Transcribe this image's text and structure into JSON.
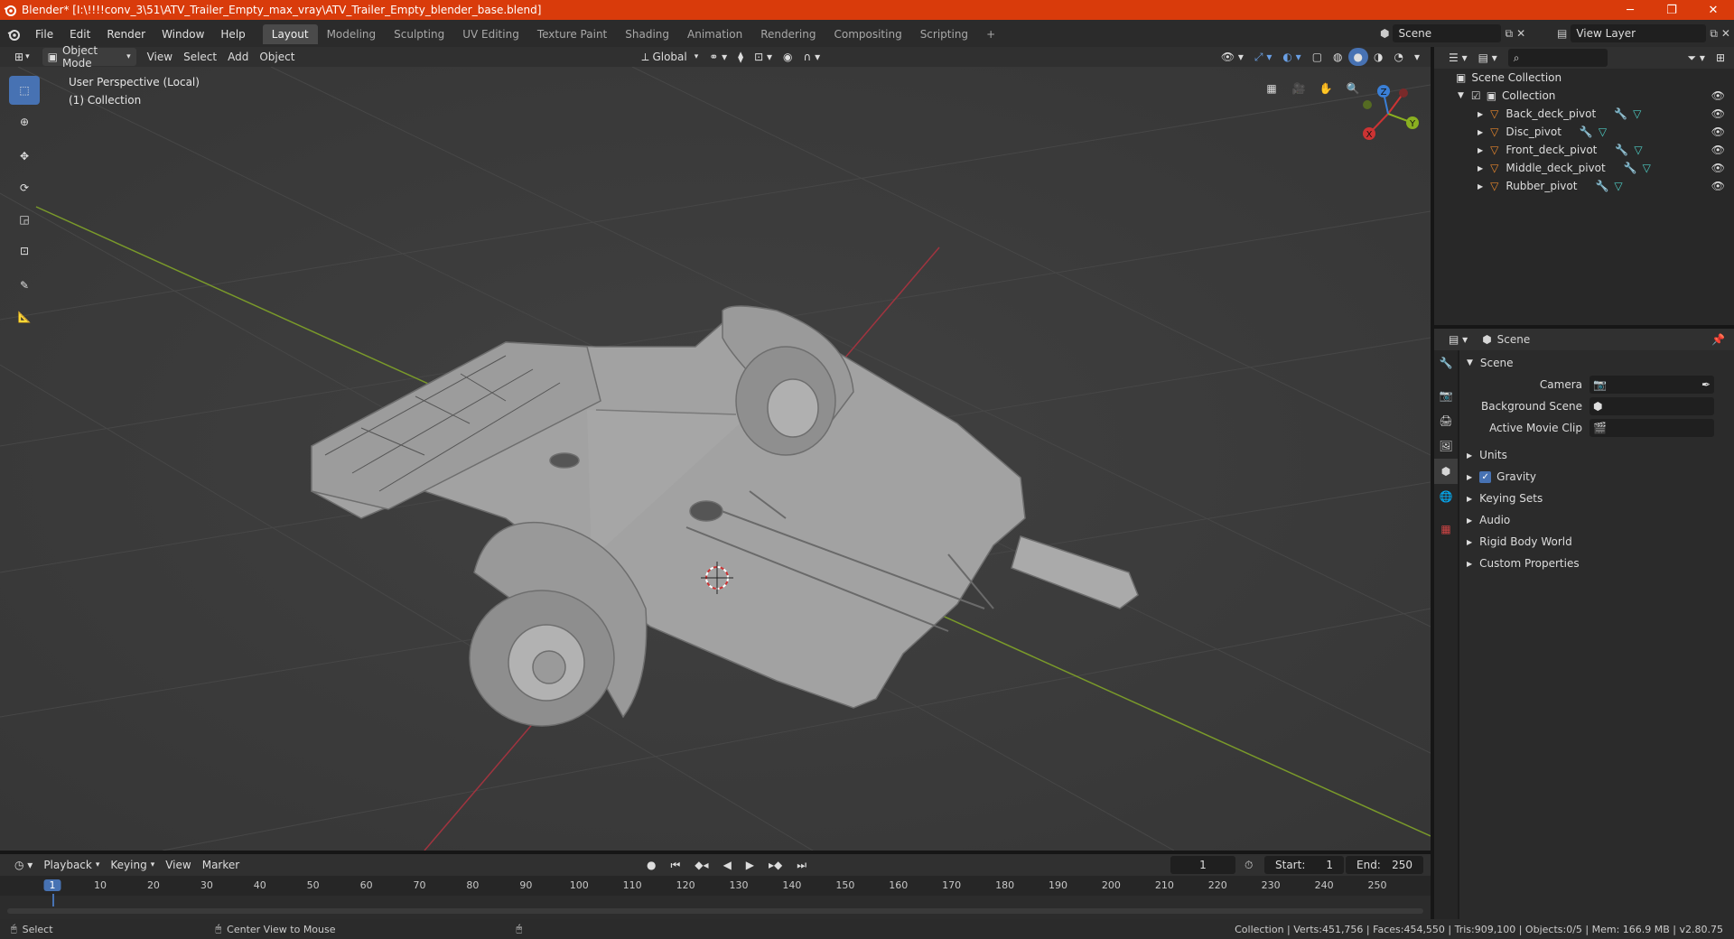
{
  "window": {
    "title": "Blender* [I:\\!!!!conv_3\\51\\ATV_Trailer_Empty_max_vray\\ATV_Trailer_Empty_blender_base.blend]",
    "controls": [
      "─",
      "❐",
      "✕"
    ]
  },
  "menu": {
    "items": [
      "File",
      "Edit",
      "Render",
      "Window",
      "Help"
    ],
    "workspaces": [
      "Layout",
      "Modeling",
      "Sculpting",
      "UV Editing",
      "Texture Paint",
      "Shading",
      "Animation",
      "Rendering",
      "Compositing",
      "Scripting"
    ],
    "active_workspace": "Layout",
    "scene": "Scene",
    "view_layer": "View Layer"
  },
  "viewport_header": {
    "mode": "Object Mode",
    "menus": [
      "View",
      "Select",
      "Add",
      "Object"
    ],
    "transform_orientation": "Global"
  },
  "viewport": {
    "perspective_label": "User Perspective (Local)",
    "collection_label": "(1) Collection",
    "gizmo": {
      "x": "X",
      "y": "Y",
      "z": "Z"
    }
  },
  "outliner": {
    "root": "Scene Collection",
    "collection": "Collection",
    "objects": [
      "Back_deck_pivot",
      "Disc_pivot",
      "Front_deck_pivot",
      "Middle_deck_pivot",
      "Rubber_pivot"
    ]
  },
  "properties": {
    "header": "Scene",
    "panel_title": "Scene",
    "fields": [
      {
        "label": "Camera"
      },
      {
        "label": "Background Scene"
      },
      {
        "label": "Active Movie Clip"
      }
    ],
    "sections": [
      "Units",
      "Gravity",
      "Keying Sets",
      "Audio",
      "Rigid Body World",
      "Custom Properties"
    ]
  },
  "timeline": {
    "menus": [
      "Playback",
      "Keying",
      "View",
      "Marker"
    ],
    "current_frame": "1",
    "start_label": "Start:",
    "start": "1",
    "end_label": "End:",
    "end": "250",
    "ruler": [
      "1",
      "10",
      "20",
      "30",
      "40",
      "50",
      "60",
      "70",
      "80",
      "90",
      "100",
      "110",
      "120",
      "130",
      "140",
      "150",
      "160",
      "170",
      "180",
      "190",
      "200",
      "210",
      "220",
      "230",
      "240",
      "250"
    ]
  },
  "statusbar": {
    "select": "Select",
    "center_view": "Center View to Mouse",
    "stats": "Collection | Verts:451,756 | Faces:454,550 | Tris:909,100 | Objects:0/5 | Mem: 166.9 MB | v2.80.75"
  },
  "colors": {
    "title_bar": "#d93b0b",
    "accent": "#4772b3",
    "axis_x": "#a0343f",
    "axis_y": "#7a9a2a",
    "object_icon": "#e8872c"
  }
}
